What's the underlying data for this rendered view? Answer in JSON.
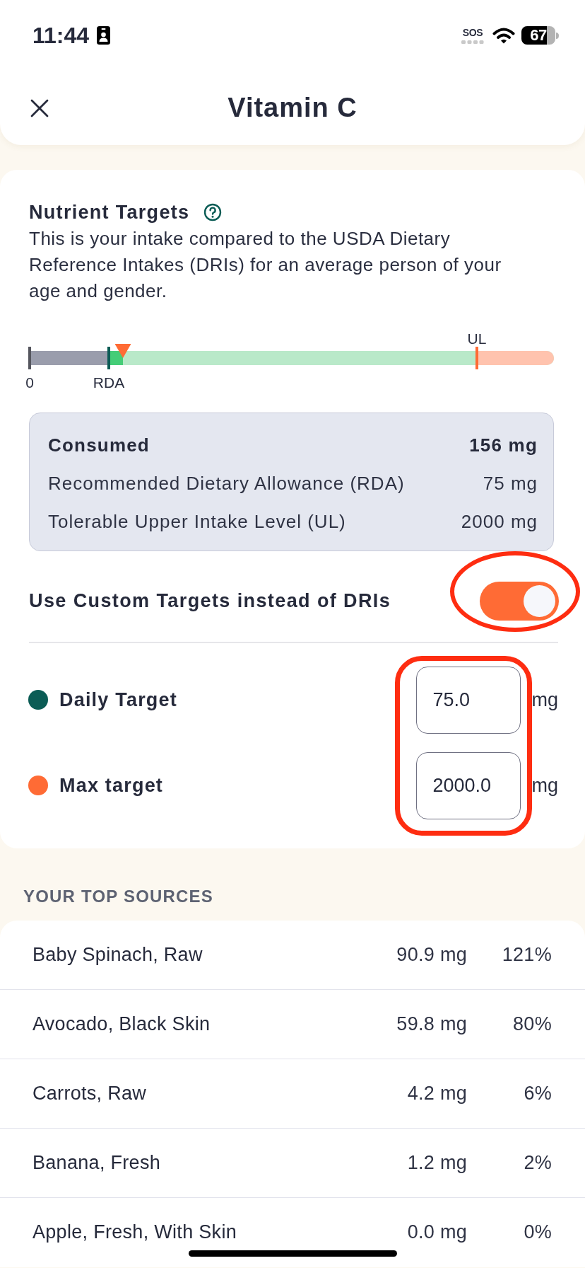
{
  "status_bar": {
    "time": "11:44",
    "sos": "SOS",
    "battery": "67"
  },
  "header": {
    "title": "Vitamin C"
  },
  "nutrient_targets": {
    "title": "Nutrient Targets",
    "description": "This is your intake compared to the USDA Dietary Reference Intakes (DRIs) for an average person of your age and gender.",
    "scale": {
      "markers": [
        {
          "kind": "zero",
          "label": "0",
          "level": 0
        },
        {
          "kind": "rda",
          "label": "RDA",
          "level": 0.151
        },
        {
          "kind": "ul",
          "label": "UL",
          "level": 0.853
        }
      ],
      "consumed": {
        "level": 0.178
      }
    },
    "summary": [
      {
        "kind": "total",
        "label": "Consumed",
        "value": "156 mg"
      },
      {
        "kind": "reference",
        "label": "Recommended Dietary Allowance (RDA)",
        "value": "75 mg"
      },
      {
        "kind": "reference",
        "label": "Tolerable Upper Intake Level (UL)",
        "value": "2000 mg"
      }
    ],
    "custom_targets": {
      "label": "Use Custom Targets instead of DRIs",
      "on": true,
      "circled": true
    },
    "targets": {
      "boxed": true,
      "items": [
        {
          "label": "Daily Target",
          "value": "75.0",
          "unit": "mg",
          "color": "#0b5c55"
        },
        {
          "label": "Max target",
          "value": "2000.0",
          "unit": "mg",
          "color": "#ff6b35"
        }
      ]
    }
  },
  "top_sources": {
    "title": "YOUR TOP SOURCES",
    "rows": [
      {
        "name": "Baby Spinach, Raw",
        "amount": "90.9 mg",
        "percent": "121%"
      },
      {
        "name": "Avocado, Black Skin",
        "amount": "59.8 mg",
        "percent": "80%"
      },
      {
        "name": "Carrots, Raw",
        "amount": "4.2 mg",
        "percent": "6%"
      },
      {
        "name": "Banana, Fresh",
        "amount": "1.2 mg",
        "percent": "2%"
      },
      {
        "name": "Apple, Fresh, With Skin",
        "amount": "0.0 mg",
        "percent": "0%"
      }
    ]
  }
}
